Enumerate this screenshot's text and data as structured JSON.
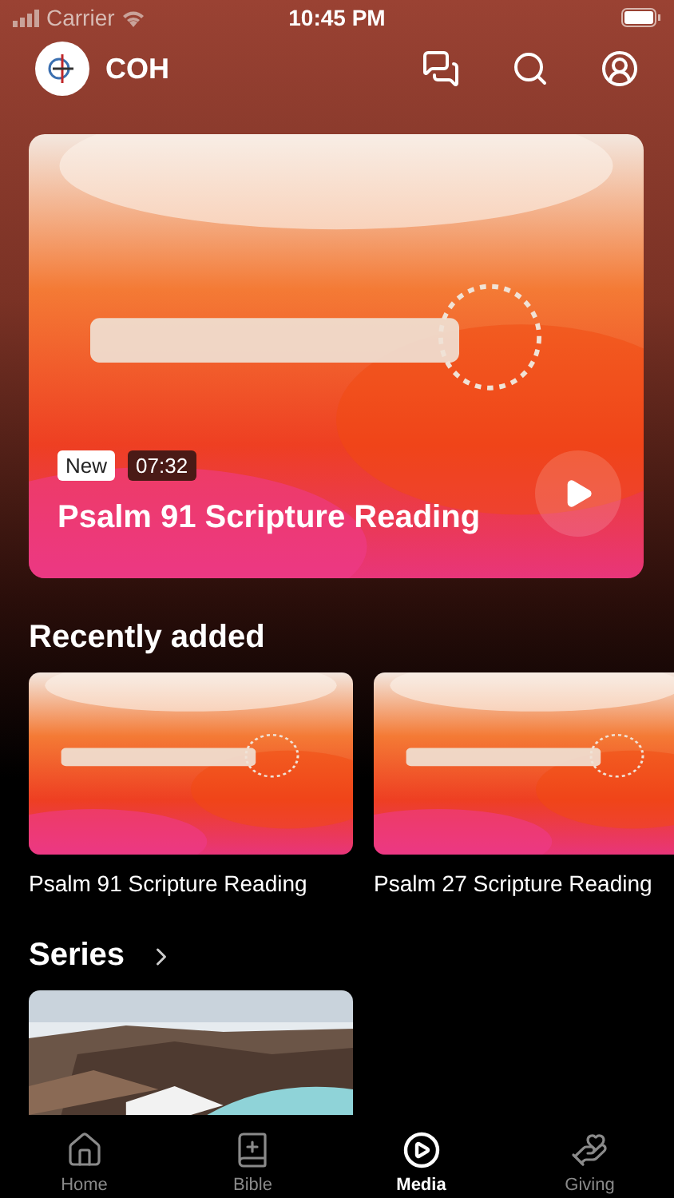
{
  "status_bar": {
    "carrier": "Carrier",
    "time": "10:45 PM"
  },
  "header": {
    "app_name": "COH"
  },
  "hero": {
    "kind": "picture",
    "badge": "New",
    "duration": "07:32",
    "title": "Psalm 91 Scripture Reading"
  },
  "recently_added": {
    "title": "Recently added",
    "items": [
      {
        "kind": "picture",
        "title": "Psalm 91 Scripture Reading"
      },
      {
        "kind": "picture",
        "title": "Psalm 27 Scripture Reading"
      }
    ]
  },
  "series": {
    "title": "Series"
  },
  "tab_bar": {
    "items": [
      {
        "label": "Home",
        "selected": false
      },
      {
        "label": "Bible",
        "selected": false
      },
      {
        "label": "Media",
        "selected": true
      },
      {
        "label": "Giving",
        "selected": false
      }
    ]
  }
}
